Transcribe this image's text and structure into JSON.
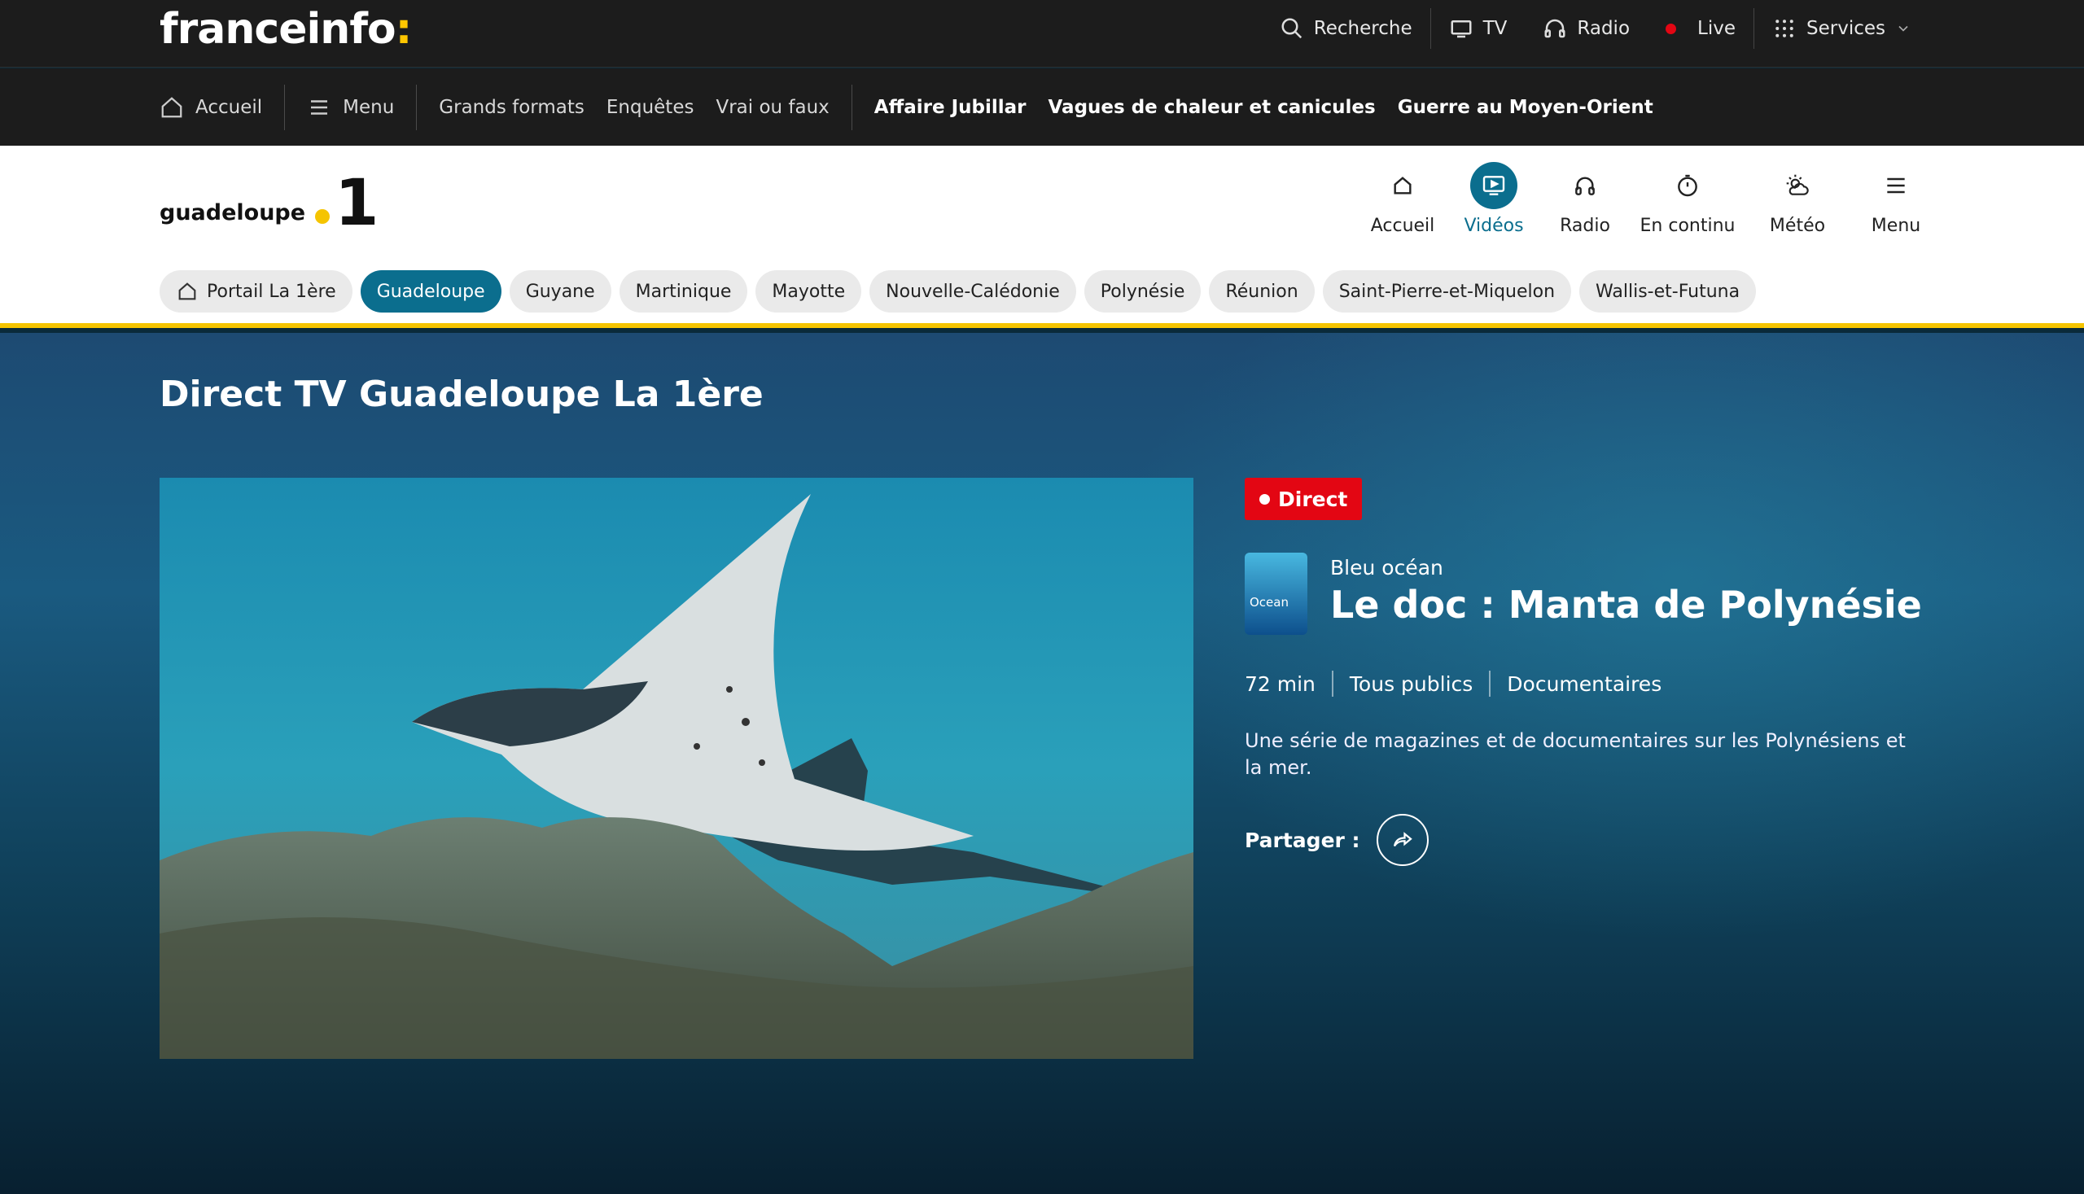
{
  "topbar": {
    "logo_text": "franceinfo",
    "logo_colon": ":",
    "nav": [
      {
        "label": "Recherche",
        "icon": "search-icon"
      },
      {
        "label": "TV",
        "icon": "tv-icon"
      },
      {
        "label": "Radio",
        "icon": "headphones-icon"
      },
      {
        "label": "Live",
        "icon": "live-dot-icon"
      },
      {
        "label": "Services",
        "icon": "grid-icon"
      }
    ]
  },
  "subnav": {
    "home": "Accueil",
    "menu": "Menu",
    "links": [
      "Grands formats",
      "Enquêtes",
      "Vrai ou faux"
    ],
    "hot": [
      "Affaire Jubillar",
      "Vagues de chaleur et canicules",
      "Guerre au Moyen-Orient"
    ]
  },
  "brand": {
    "name": "guadeloupe",
    "number": "1"
  },
  "mainnav": [
    {
      "label": "Accueil",
      "icon": "home-icon"
    },
    {
      "label": "Vidéos",
      "icon": "video-icon"
    },
    {
      "label": "Radio",
      "icon": "headphones-icon"
    },
    {
      "label": "En continu",
      "icon": "timer-icon"
    },
    {
      "label": "Météo",
      "icon": "weather-icon"
    },
    {
      "label": "Menu",
      "icon": "hamburger-icon"
    }
  ],
  "chips": [
    "Portail La 1ère",
    "Guadeloupe",
    "Guyane",
    "Martinique",
    "Mayotte",
    "Nouvelle-Calédonie",
    "Polynésie",
    "Réunion",
    "Saint-Pierre-et-Miquelon",
    "Wallis-et-Futuna"
  ],
  "page": {
    "title": "Direct TV Guadeloupe La 1ère",
    "badge": "Direct",
    "thumb_label": "Ocean",
    "channel": "Bleu océan",
    "program_title": "Le doc : Manta de Polynésie",
    "duration": "72 min",
    "audience": "Tous publics",
    "genre": "Documentaires",
    "description": "Une série de magazines et de documentaires sur les Polynésiens et la mer.",
    "share_label": "Partager :"
  },
  "colors": {
    "accent": "#0b6e8e",
    "brand_yellow": "#f5c400",
    "live_red": "#e30613"
  }
}
